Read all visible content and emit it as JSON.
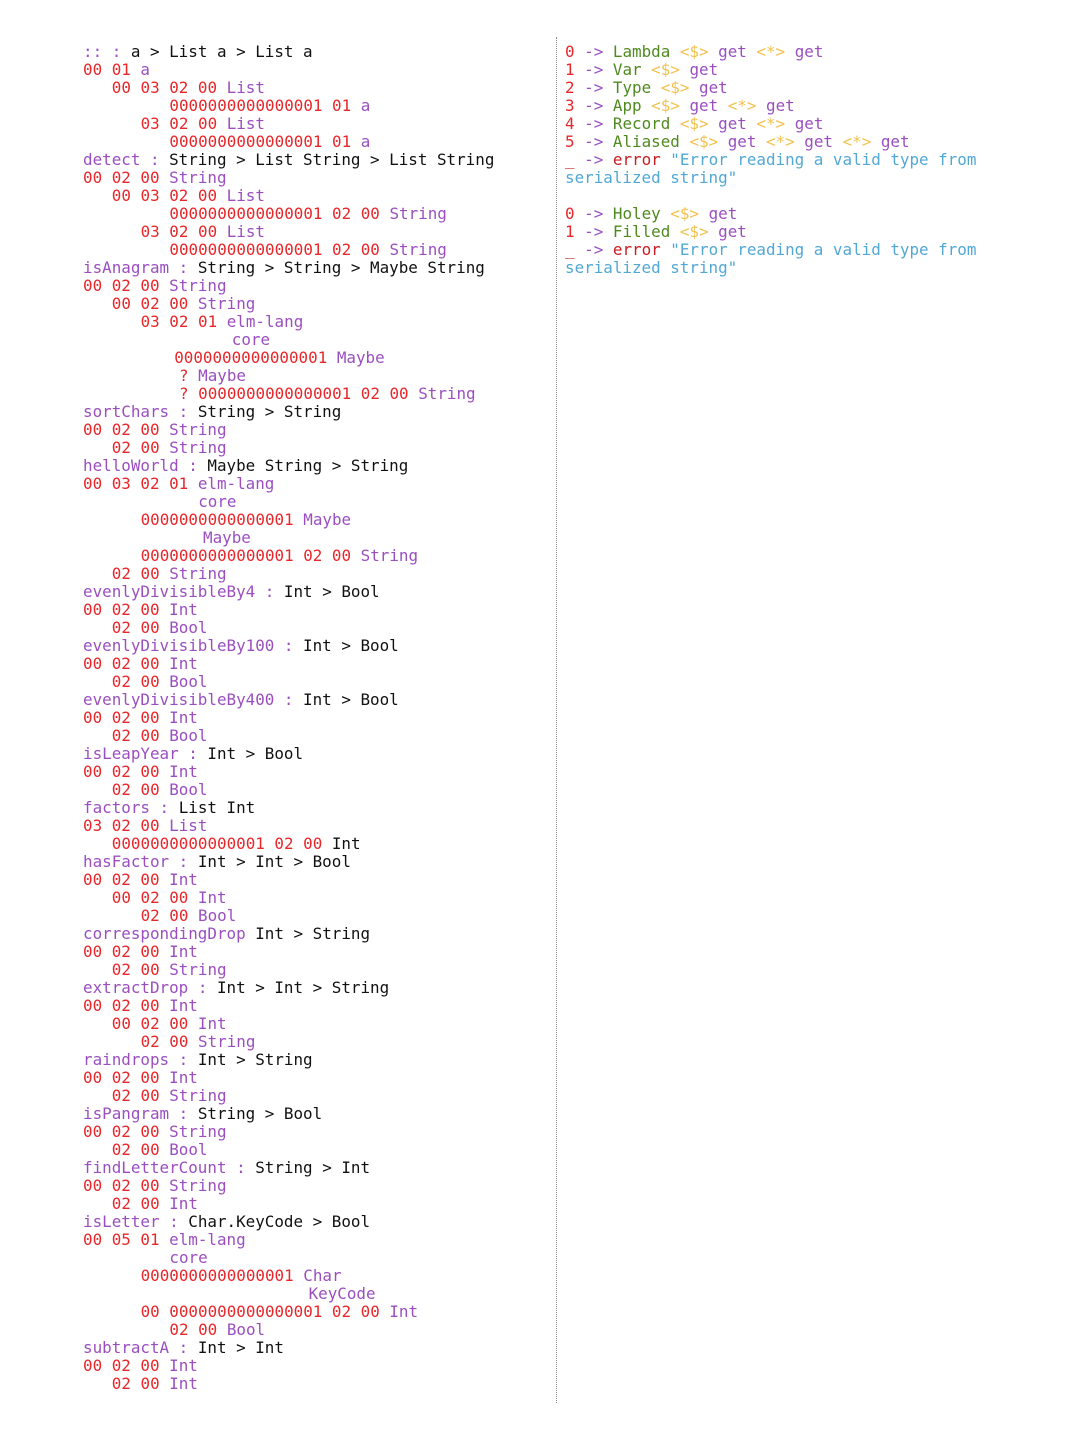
{
  "left_lines": [
    {
      "indent": 0,
      "kind": "sig",
      "name": "::",
      "sep": " : ",
      "type": "a > List a > List a"
    },
    {
      "indent": 0,
      "kind": "code",
      "num": "00 01",
      "sym": "a"
    },
    {
      "indent": 3,
      "kind": "code",
      "num": "00 03 02 00",
      "sym": "List"
    },
    {
      "indent": 9,
      "kind": "code",
      "num": "0000000000000001 01",
      "sym": "a"
    },
    {
      "indent": 6,
      "kind": "code",
      "num": "03 02 00",
      "sym": "List"
    },
    {
      "indent": 9,
      "kind": "code",
      "num": "0000000000000001 01",
      "sym": "a"
    },
    {
      "indent": 0,
      "kind": "sig",
      "name": "detect",
      "sep": " : ",
      "type": "String > List String > List String"
    },
    {
      "indent": 0,
      "kind": "code",
      "num": "00 02 00",
      "sym": "String"
    },
    {
      "indent": 3,
      "kind": "code",
      "num": "00 03 02 00",
      "sym": "List"
    },
    {
      "indent": 9,
      "kind": "code",
      "num": "0000000000000001 02 00",
      "sym": "String"
    },
    {
      "indent": 6,
      "kind": "code",
      "num": "03 02 00",
      "sym": "List"
    },
    {
      "indent": 9,
      "kind": "code",
      "num": "0000000000000001 02 00",
      "sym": "String"
    },
    {
      "indent": 0,
      "kind": "sig",
      "name": "isAnagram",
      "sep": " : ",
      "type": "String > String > Maybe String"
    },
    {
      "indent": 0,
      "kind": "code",
      "num": "00 02 00",
      "sym": "String"
    },
    {
      "indent": 3,
      "kind": "code",
      "num": "00 02 00",
      "sym": "String"
    },
    {
      "indent": 6,
      "kind": "code",
      "num": "03 02 01",
      "sym": "elm-lang"
    },
    {
      "indent": 15.5,
      "kind": "code",
      "num": "",
      "sym": "core"
    },
    {
      "indent": 9.5,
      "kind": "code",
      "num": "0000000000000001",
      "sym": "Maybe"
    },
    {
      "indent": 10,
      "kind": "code",
      "num": "?",
      "sym": "Maybe"
    },
    {
      "indent": 10,
      "kind": "code",
      "num": "? 0000000000000001 02 00",
      "sym": "String"
    },
    {
      "indent": 0,
      "kind": "sig",
      "name": "sortChars",
      "sep": " : ",
      "type": "String > String"
    },
    {
      "indent": 0,
      "kind": "code",
      "num": "00 02 00",
      "sym": "String"
    },
    {
      "indent": 3,
      "kind": "code",
      "num": "02 00",
      "sym": "String"
    },
    {
      "indent": 0,
      "kind": "sig",
      "name": "helloWorld",
      "sep": " : ",
      "type": "Maybe String > String"
    },
    {
      "indent": 0,
      "kind": "code",
      "num": "00 03 02 01",
      "sym": "elm-lang"
    },
    {
      "indent": 12,
      "kind": "code",
      "num": "",
      "sym": "core"
    },
    {
      "indent": 6,
      "kind": "code",
      "num": "0000000000000001",
      "sym": "Maybe"
    },
    {
      "indent": 12.5,
      "kind": "code",
      "num": "",
      "sym": "Maybe"
    },
    {
      "indent": 6,
      "kind": "code",
      "num": "0000000000000001 02 00",
      "sym": "String"
    },
    {
      "indent": 3,
      "kind": "code",
      "num": "02 00",
      "sym": "String"
    },
    {
      "indent": 0,
      "kind": "sig",
      "name": "evenlyDivisibleBy4",
      "sep": " : ",
      "type": "Int > Bool"
    },
    {
      "indent": 0,
      "kind": "code",
      "num": "00 02 00",
      "sym": "Int"
    },
    {
      "indent": 3,
      "kind": "code",
      "num": "02 00",
      "sym": "Bool"
    },
    {
      "indent": 0,
      "kind": "sig",
      "name": "evenlyDivisibleBy100",
      "sep": " : ",
      "type": "Int > Bool"
    },
    {
      "indent": 0,
      "kind": "code",
      "num": "00 02 00",
      "sym": "Int"
    },
    {
      "indent": 3,
      "kind": "code",
      "num": "02 00",
      "sym": "Bool"
    },
    {
      "indent": 0,
      "kind": "sig",
      "name": "evenlyDivisibleBy400",
      "sep": " : ",
      "type": "Int > Bool"
    },
    {
      "indent": 0,
      "kind": "code",
      "num": "00 02 00",
      "sym": "Int"
    },
    {
      "indent": 3,
      "kind": "code",
      "num": "02 00",
      "sym": "Bool"
    },
    {
      "indent": 0,
      "kind": "sig",
      "name": "isLeapYear",
      "sep": " : ",
      "type": "Int > Bool"
    },
    {
      "indent": 0,
      "kind": "code",
      "num": "00 02 00",
      "sym": "Int"
    },
    {
      "indent": 3,
      "kind": "code",
      "num": "02 00",
      "sym": "Bool"
    },
    {
      "indent": 0,
      "kind": "sig",
      "name": "factors",
      "sep": " : ",
      "type": "List Int"
    },
    {
      "indent": 0,
      "kind": "code",
      "num": "03 02 00",
      "sym": "List"
    },
    {
      "indent": 3,
      "kind": "code",
      "num": "0000000000000001 02 00",
      "sym": "Int",
      "sym_plain": true
    },
    {
      "indent": 0,
      "kind": "sig",
      "name": "hasFactor",
      "sep": " : ",
      "type": "Int > Int > Bool"
    },
    {
      "indent": 0,
      "kind": "code",
      "num": "00 02 00",
      "sym": "Int"
    },
    {
      "indent": 3,
      "kind": "code",
      "num": "00 02 00",
      "sym": "Int"
    },
    {
      "indent": 6,
      "kind": "code",
      "num": "02 00",
      "sym": "Bool"
    },
    {
      "indent": 0,
      "kind": "sig",
      "name": "correspondingDrop",
      "sep": " ",
      "type": "Int > String"
    },
    {
      "indent": 0,
      "kind": "code",
      "num": "00 02 00",
      "sym": "Int"
    },
    {
      "indent": 3,
      "kind": "code",
      "num": "02 00",
      "sym": "String"
    },
    {
      "indent": 0,
      "kind": "sig",
      "name": "extractDrop",
      "sep": " : ",
      "type": "Int > Int > String"
    },
    {
      "indent": 0,
      "kind": "code",
      "num": "00 02 00",
      "sym": "Int"
    },
    {
      "indent": 3,
      "kind": "code",
      "num": "00 02 00",
      "sym": "Int"
    },
    {
      "indent": 6,
      "kind": "code",
      "num": "02 00",
      "sym": "String"
    },
    {
      "indent": 0,
      "kind": "sig",
      "name": "raindrops",
      "sep": " : ",
      "type": "Int > String"
    },
    {
      "indent": 0,
      "kind": "code",
      "num": "00 02 00",
      "sym": "Int"
    },
    {
      "indent": 3,
      "kind": "code",
      "num": "02 00",
      "sym": "String"
    },
    {
      "indent": 0,
      "kind": "sig",
      "name": "isPangram",
      "sep": " : ",
      "type": "String > Bool"
    },
    {
      "indent": 0,
      "kind": "code",
      "num": "00 02 00",
      "sym": "String"
    },
    {
      "indent": 3,
      "kind": "code",
      "num": "02 00",
      "sym": "Bool"
    },
    {
      "indent": 0,
      "kind": "sig",
      "name": "findLetterCount",
      "sep": " : ",
      "type": "String > Int"
    },
    {
      "indent": 0,
      "kind": "code",
      "num": "00 02 00",
      "sym": "String"
    },
    {
      "indent": 3,
      "kind": "code",
      "num": "02 00",
      "sym": "Int"
    },
    {
      "indent": 0,
      "kind": "sig",
      "name": "isLetter",
      "sep": " : ",
      "type": "Char.KeyCode > Bool"
    },
    {
      "indent": 0,
      "kind": "code",
      "num": "00 05 01",
      "sym": "elm-lang"
    },
    {
      "indent": 9,
      "kind": "code",
      "num": "",
      "sym": "core"
    },
    {
      "indent": 6,
      "kind": "code",
      "num": "0000000000000001",
      "sym": "Char"
    },
    {
      "indent": 23.5,
      "kind": "code",
      "num": "",
      "sym": "KeyCode"
    },
    {
      "indent": 6,
      "kind": "code",
      "num": "00 0000000000000001 02 00",
      "sym": "Int"
    },
    {
      "indent": 9,
      "kind": "code",
      "num": "02 00",
      "sym": "Bool"
    },
    {
      "indent": 0,
      "kind": "sig",
      "name": "subtractA",
      "sep": " : ",
      "type": "Int > Int"
    },
    {
      "indent": 0,
      "kind": "code",
      "num": "00 02 00",
      "sym": "Int"
    },
    {
      "indent": 3,
      "kind": "code",
      "num": "02 00",
      "sym": "Int"
    }
  ],
  "right_blocks": [
    {
      "cases": [
        {
          "tag": "0",
          "ctor": "Lambda",
          "applies": 2
        },
        {
          "tag": "1",
          "ctor": "Var",
          "applies": 1
        },
        {
          "tag": "2",
          "ctor": "Type",
          "applies": 1
        },
        {
          "tag": "3",
          "ctor": "App",
          "applies": 2
        },
        {
          "tag": "4",
          "ctor": "Record",
          "applies": 2
        },
        {
          "tag": "5",
          "ctor": "Aliased",
          "applies": 3
        }
      ],
      "fallback": {
        "tag": "_",
        "keyword": "error",
        "message": "\"Error reading a valid type from serialized string\""
      }
    },
    {
      "cases": [
        {
          "tag": "0",
          "ctor": "Holey",
          "applies": 1
        },
        {
          "tag": "1",
          "ctor": "Filled",
          "applies": 1
        }
      ],
      "fallback": {
        "tag": "_",
        "keyword": "error",
        "message": "\"Error reading a valid type from serialized string\""
      }
    }
  ],
  "tokens": {
    "arrow": "->",
    "fmap": "<$>",
    "ap": "<*>",
    "get": "get"
  },
  "colors": {
    "name": "#9b4fbf",
    "number": "#e8272b",
    "type": "#111111",
    "constructor": "#4f8a1f",
    "operator": "#f2c14e",
    "string": "#52a8d4",
    "error": "#c81e22"
  }
}
